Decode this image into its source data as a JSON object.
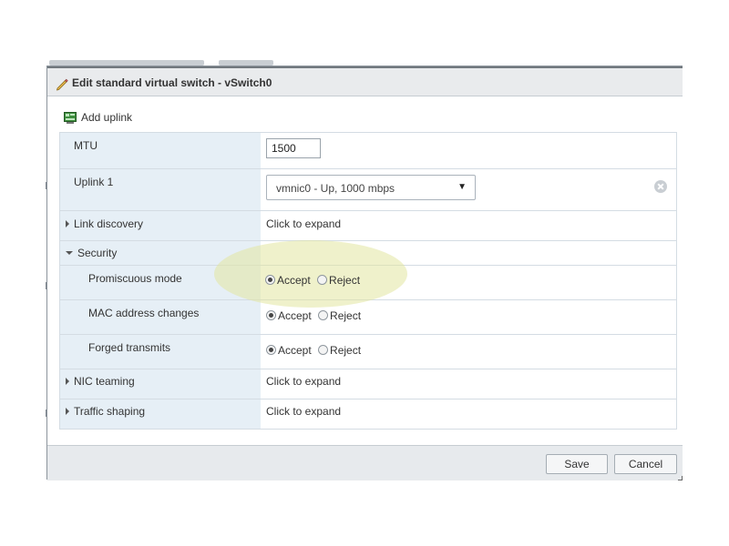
{
  "dialog": {
    "title": "Edit standard virtual switch - vSwitch0",
    "add_uplink_label": "Add uplink",
    "save_label": "Save",
    "cancel_label": "Cancel"
  },
  "fields": {
    "mtu": {
      "label": "MTU",
      "value": "1500"
    },
    "uplink1": {
      "label": "Uplink 1",
      "selected": "vmnic0 - Up, 1000 mbps"
    },
    "link_discovery": {
      "label": "Link discovery",
      "value": "Click to expand"
    },
    "security": {
      "label": "Security",
      "promiscuous": {
        "label": "Promiscuous mode",
        "selected": "Accept"
      },
      "mac_changes": {
        "label": "MAC address changes",
        "selected": "Accept"
      },
      "forged": {
        "label": "Forged transmits",
        "selected": "Accept"
      }
    },
    "nic_teaming": {
      "label": "NIC teaming",
      "value": "Click to expand"
    },
    "traffic_shaping": {
      "label": "Traffic shaping",
      "value": "Click to expand"
    }
  },
  "radio_options": {
    "accept": "Accept",
    "reject": "Reject"
  },
  "colors": {
    "label_column": "#e6eff6",
    "title_bar": "#e9ebed",
    "highlight": "#e2e5a0"
  }
}
